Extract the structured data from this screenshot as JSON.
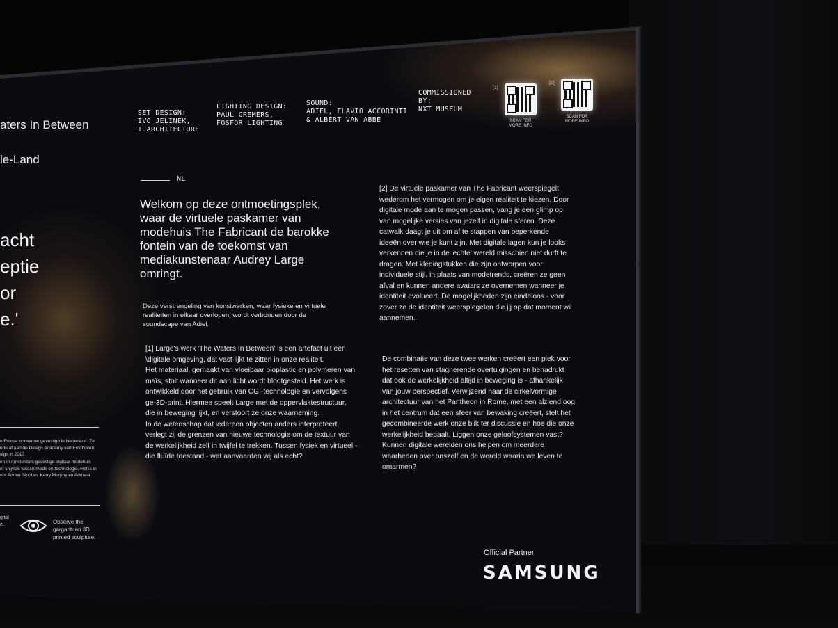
{
  "credits": [
    {
      "id": "set",
      "text": "SET DESIGN:\nIVO JELINEK,\nIJARCHITECTURE"
    },
    {
      "id": "light",
      "text": "LIGHTING DESIGN:\nPAUL CREMERS,\nFOSFOR LIGHTING"
    },
    {
      "id": "sound",
      "text": "SOUND:\nADIEL, FLAVIO ACCORINTI\n& ALBERT VAN ABBE"
    },
    {
      "id": "commissioned",
      "text": "COMMISSIONED\nBY:\nNXT MUSEUM"
    }
  ],
  "qr": [
    {
      "marker": "[1]",
      "label": "SCAN FOR\nMORE INFO"
    },
    {
      "marker": "[2]",
      "label": "SCAN FOR\nMORE INFO"
    }
  ],
  "language_label": "NL",
  "lead": "Welkom op deze ontmoetingsplek,\nwaar de virtuele paskamer van\nmodehuis The Fabricant de barokke\nfontein van de toekomst van\nmediakunstenaar Audrey Large\nomringt.",
  "intro": "Deze verstrengeling van kunstwerken, waar fysieke en virtuele\nrealiteiten in elkaar overlopen, wordt verbonden door de\nsoundscape van Adiel.",
  "para1": "[1] Large's werk 'The Waters In Between' is een artefact uit een\n\\digitale omgeving, dat vast lijkt te zitten in onze realiteit.\nHet materiaal, gemaakt van vloeibaar bioplastic en polymeren van\nmaïs, stolt wanneer dit aan licht wordt blootgesteld. Het werk is\nontwikkeld door het gebruik van  CGI-technologie en vervolgens\nge-3D-print. Hiermee speelt Large met de oppervlaktestructuur,\ndie in beweging lijkt, en verstoort ze onze waarneming.\nIn de wetenschap dat iedereen objecten anders interpreteert,\nverlegt zij de grenzen van nieuwe technologie om de textuur van\nde werkelijkheid zelf in twijfel te trekken. Tussen fysiek en virtueel -\ndie fluïde toestand - wat aanvaarden wij  als echt?",
  "para2": "[2] De virtuele paskamer van The Fabricant weerspiegelt\nwederom het vermogen om je eigen realiteit te kiezen. Door\ndigitale mode aan te mogen passen, vang je een glimp op\nvan mogelijke versies van jezelf in digitale sferen. Deze\ncatwalk daagt je uit om af te stappen van beperkende\nideeën over wie je kunt zijn. Met digitale lagen kun je looks\nverkennen die je in de 'echte' wereld misschien niet durft te\ndragen. Met kledingstukken die zijn ontworpen voor\nindividuele stijl, in plaats van modetrends, creëren ze geen\nafval en kunnen andere avatars ze overnemen wanneer je\nidentiteit evolueert. De mogelijkheden zijn eindeloos - voor\nzover ze de identiteit weerspiegelen die jij op dat moment wil\naannemen.",
  "para3": "De combinatie van deze twee werken creëert een plek voor\nhet resetten van stagnerende overtuigingen en benadrukt\ndat ook de werkelijkheid altijd in beweging is - afhankelijk\nvan jouw perspectief. Verwijzend naar de cirkelvormige\narchitectuur van het Pantheon in Rome, met een alziend oog\nin het centrum dat een sfeer van bewaking creëert, stelt het\ngecombineerde werk onze blik ter discussie en hoe die onze\nwerkelijkheid bepaalt. Liggen onze geloofsystemen vast?\nKunnen digitale werelden ons helpen om meerdere\nwaarheden over onszelf en de wereld waarin we leven te\nomarmen?",
  "left_panel": {
    "title1": "aters In Between",
    "title2": "le-Land",
    "big": "acht\neptie\nor\ne.'",
    "bio1": "n Franse ontwerper gevestigd in Nederland. Ze\nude af aan de Design Academy van Eindhoven\nsign in 2017.",
    "bio2": "en in Amsterdam gevestigd digitaal modehuis\net snijvlak tussen mode en technologie. Het is in\noor Amber Slooten, Kerry Murphy en Adriana",
    "frag": "gital\ne.",
    "eye_text": "Observe the\ngargantuan 3D\nprinted sculpture."
  },
  "partner": {
    "label": "Official Partner",
    "brand": "SAMSUNG"
  }
}
